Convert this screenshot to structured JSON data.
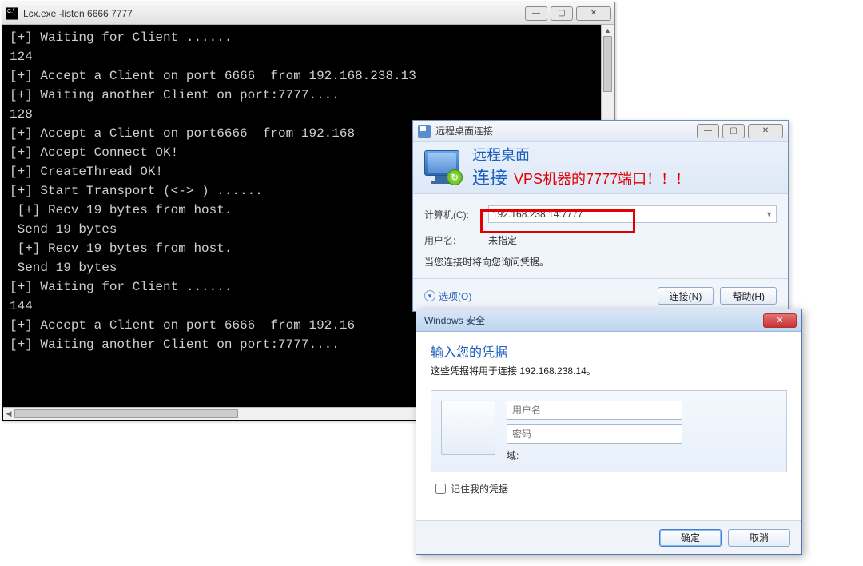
{
  "console": {
    "title": "Lcx.exe  -listen 6666 7777",
    "lines": [
      "[+] Waiting for Client ......",
      "124",
      "[+] Accept a Client on port 6666  from 192.168.238.13",
      "[+] Waiting another Client on port:7777....",
      "128",
      "[+] Accept a Client on port6666  from 192.168",
      "[+] Accept Connect OK!",
      "[+] CreateThread OK!",
      "[+] Start Transport (<-> ) ......",
      " [+] Recv 19 bytes from host.",
      " Send 19 bytes",
      " [+] Recv 19 bytes from host.",
      " Send 19 bytes",
      "[+] Waiting for Client ......",
      "144",
      "[+] Accept a Client on port 6666  from 192.16",
      "[+] Waiting another Client on port:7777...."
    ]
  },
  "rdp": {
    "window_title": "远程桌面连接",
    "header_line1": "远程桌面",
    "header_line2": "连接",
    "annotation": "VPS机器的7777端口！！！",
    "computer_label": "计算机(C):",
    "computer_value": "192.168.238.14:7777",
    "user_label": "用户名:",
    "user_value": "未指定",
    "hint": "当您连接时将向您询问凭据。",
    "options_label": "选项(O)",
    "connect_label": "连接(N)",
    "help_label": "帮助(H)"
  },
  "sec": {
    "window_title": "Windows 安全",
    "heading": "输入您的凭据",
    "subtext": "这些凭据将用于连接 192.168.238.14。",
    "username_placeholder": "用户名",
    "password_placeholder": "密码",
    "domain_label": "域:",
    "remember_label": "记住我的凭据",
    "ok_label": "确定",
    "cancel_label": "取消"
  }
}
